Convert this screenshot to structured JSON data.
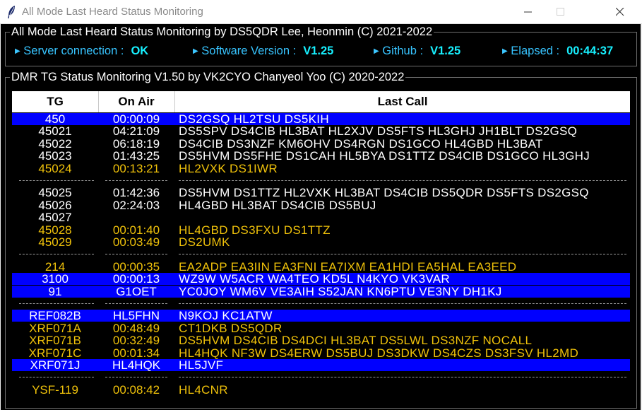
{
  "window": {
    "title": "All Mode Last Heard Status Monitoring",
    "icon": "feather-icon"
  },
  "top_frame": {
    "legend": "All Mode Last Heard Status Monitoring  by DS5QDR Lee, Heonmin (C) 2021-2022",
    "server": {
      "label": "Server connection :",
      "value": "OK"
    },
    "software": {
      "label": "Software Version :",
      "value": "V1.25"
    },
    "github": {
      "label": "Github :",
      "value": "V1.25"
    },
    "elapsed": {
      "label": "Elapsed :",
      "value": "00:44:37"
    }
  },
  "dmr_frame": {
    "legend": "DMR TG Status Monitoring V1.50 by VK2CYO Chanyeol Yoo (C) 2020-2022",
    "columns": [
      "TG",
      "On Air",
      "Last Call"
    ],
    "rows": [
      {
        "tg": "450",
        "on_air": "00:00:09",
        "last_call": "DS2GSQ  HL2TSU  DS5KIH",
        "style": "blue"
      },
      {
        "tg": "45021",
        "on_air": "04:21:09",
        "last_call": "DS5SPV  DS4CIB  HL3BAT  HL2XJV  DS5FTS  HL3GHJ  JH1BLT  DS2GSQ",
        "style": "white"
      },
      {
        "tg": "45022",
        "on_air": "06:18:19",
        "last_call": "DS4CIB  DS3NZF          KM6OHV  DS4RGN  DS1GCO  HL4GBD  HL3BAT",
        "style": "white"
      },
      {
        "tg": "45023",
        "on_air": "01:43:25",
        "last_call": "DS5HVM  DS5FHE  DS1CAH  HL5BYA  DS1TTZ  DS4CIB  DS1GCO  HL3GHJ",
        "style": "white"
      },
      {
        "tg": "45024",
        "on_air": "00:13:21",
        "last_call": "HL2VXK  DS1IWR",
        "style": "yellow"
      },
      {
        "separator": true
      },
      {
        "tg": "45025",
        "on_air": "01:42:36",
        "last_call": "DS5HVM  DS1TTZ  HL2VXK  HL3BAT  DS4CIB  DS5QDR  DS5FTS  DS2GSQ",
        "style": "white"
      },
      {
        "tg": "45026",
        "on_air": "02:24:03",
        "last_call": "HL4GBD  HL3BAT  DS4CIB  DS5BUJ",
        "style": "white"
      },
      {
        "tg": "45027",
        "on_air": "",
        "last_call": "",
        "style": "white"
      },
      {
        "tg": "45028",
        "on_air": "00:01:40",
        "last_call": "HL4GBD  DS3FXU  DS1TTZ",
        "style": "yellow"
      },
      {
        "tg": "45029",
        "on_air": "00:03:49",
        "last_call": "DS2UMK",
        "style": "yellow"
      },
      {
        "separator": true
      },
      {
        "tg": "214",
        "on_air": "00:00:35",
        "last_call": "EA2ADP  EA3IIN  EA3FNI  EA7IXM  EA1HDI  EA5HAL  EA3EED",
        "style": "yellow"
      },
      {
        "tg": "3100",
        "on_air": "00:00:13",
        "last_call": "WZ9W    W5ACR   WA4TEO  KD5L    N4KYO   VK3VAR",
        "style": "blue"
      },
      {
        "tg": "91",
        "on_air": "G1OET",
        "last_call": "YC0JOY  WM6V    VE3AIH  S52JAN  KN6PTU  VE3NY   DH1KJ",
        "style": "blue"
      },
      {
        "separator": true
      },
      {
        "tg": "REF082B",
        "on_air": "HL5FHN",
        "last_call": "N9KOJ   KC1ATW",
        "style": "blue"
      },
      {
        "tg": "XRF071A",
        "on_air": "00:48:49",
        "last_call": "CT1DKB  DS5QDR",
        "style": "yellow"
      },
      {
        "tg": "XRF071B",
        "on_air": "00:32:49",
        "last_call": "DS5HVM  DS4CIB  DS4DCI  HL3BAT  DS5LWL  DS3NZF  NOCALL",
        "style": "yellow"
      },
      {
        "tg": "XRF071C",
        "on_air": "00:01:34",
        "last_call": "HL4HQK  NF3W    DS4ERW  DS5BUJ  DS3DKW  DS4CZS  DS3FSV  HL2MD",
        "style": "yellow"
      },
      {
        "tg": "XRF071J",
        "on_air": "HL4HQK",
        "last_call": "HL5JVF",
        "style": "blue"
      },
      {
        "separator": true
      },
      {
        "tg": "YSF-119",
        "on_air": "00:08:42",
        "last_call": "HL4CNR",
        "style": "yellow"
      }
    ]
  }
}
